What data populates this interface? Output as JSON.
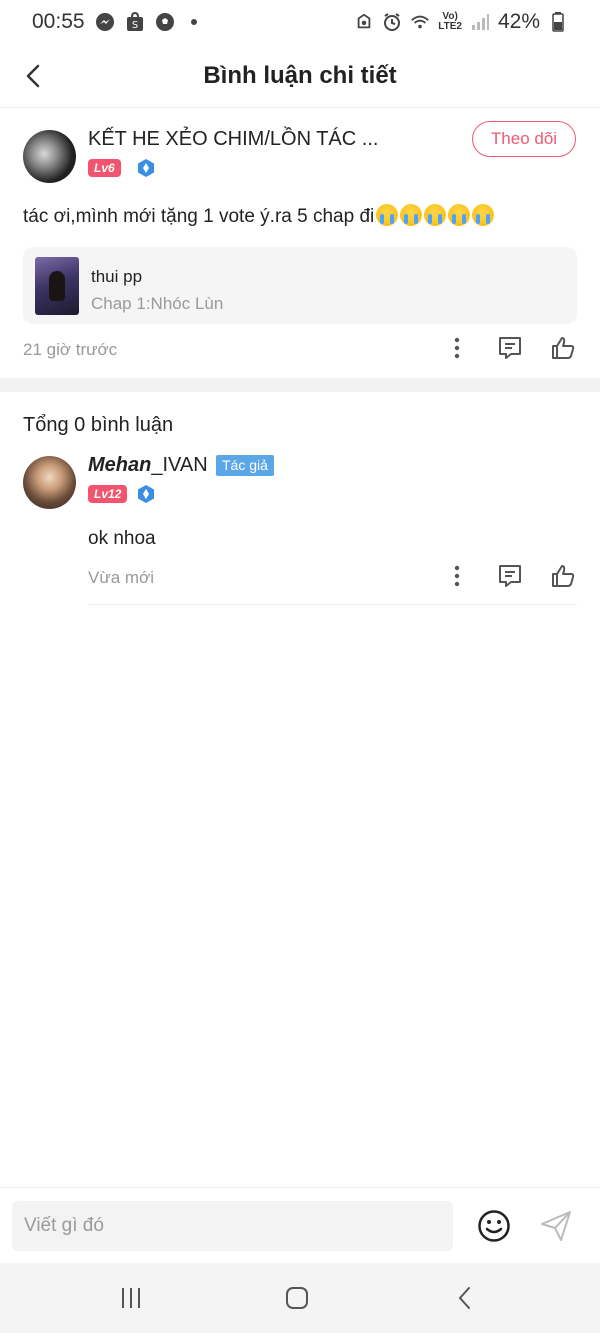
{
  "status_bar": {
    "time": "00:55",
    "battery": "42%",
    "network": "Vo)\nLTE2",
    "icons": [
      "messenger-icon",
      "shopee-icon",
      "soccer-ball-icon",
      "dot-icon",
      "recycle-icon",
      "alarm-icon",
      "wifi-icon",
      "signal-icon",
      "battery-icon"
    ]
  },
  "header": {
    "title": "Bình luận chi tiết",
    "back_icon": "back-arrow-icon"
  },
  "main_comment": {
    "username": "KẾT HE XẺO CHIM/LỒN TÁC ...",
    "level": "Lv6",
    "follow_label": "Theo dõi",
    "text": "tác ơi,mình mới tặng 1 vote ý.ra 5 chap đi",
    "emoji_count": 5,
    "chapter": {
      "name": "thui pp",
      "subtitle": "Chap 1:Nhóc Lùn"
    },
    "timestamp": "21 giờ trước"
  },
  "replies": {
    "total_label": "Tổng 0 bình luận",
    "items": [
      {
        "username_bold": "Mehan",
        "username_rest": "_IVAN",
        "author_tag": "Tác giả",
        "level": "Lv12",
        "text": "ok nhoa",
        "timestamp": "Vừa mới"
      }
    ]
  },
  "input": {
    "placeholder": "Viết gì đó"
  },
  "colors": {
    "accent": "#f05a74",
    "level_badge": "#f2546f",
    "author_tag": "#5aa7e8",
    "verified": "#3b8fe0"
  }
}
